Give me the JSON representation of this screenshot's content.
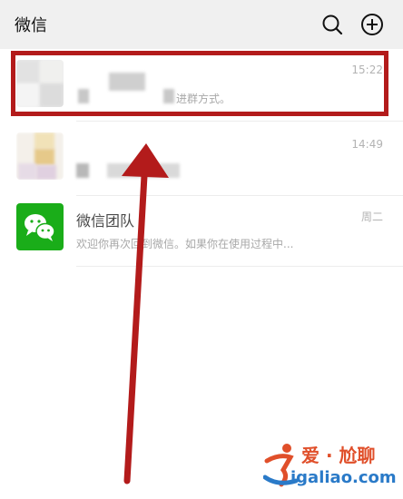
{
  "header": {
    "title": "微信",
    "search_icon": "search-icon",
    "add_icon": "plus-circle-icon"
  },
  "chats": [
    {
      "name": "",
      "time": "15:22",
      "preview": "进群方式。",
      "avatar": "blurred-group-avatar"
    },
    {
      "name": "",
      "time": "14:49",
      "preview": "",
      "avatar": "blurred-group-avatar"
    },
    {
      "name": "微信团队",
      "time": "周二",
      "preview": "欢迎你再次回到微信。如果你在使用过程中...",
      "avatar": "wechat-logo"
    }
  ],
  "annotations": {
    "highlight_color": "#b31b1b",
    "arrow_color": "#b31b1b"
  },
  "watermark": {
    "top_text": "爱 · 尬聊",
    "bottom_text": "igaliao.com"
  },
  "colors": {
    "header_bg": "#f0f0f0",
    "wechat_green": "#1aad19",
    "time_gray": "#b3b3b3",
    "preview_gray": "#a8a8a8"
  }
}
